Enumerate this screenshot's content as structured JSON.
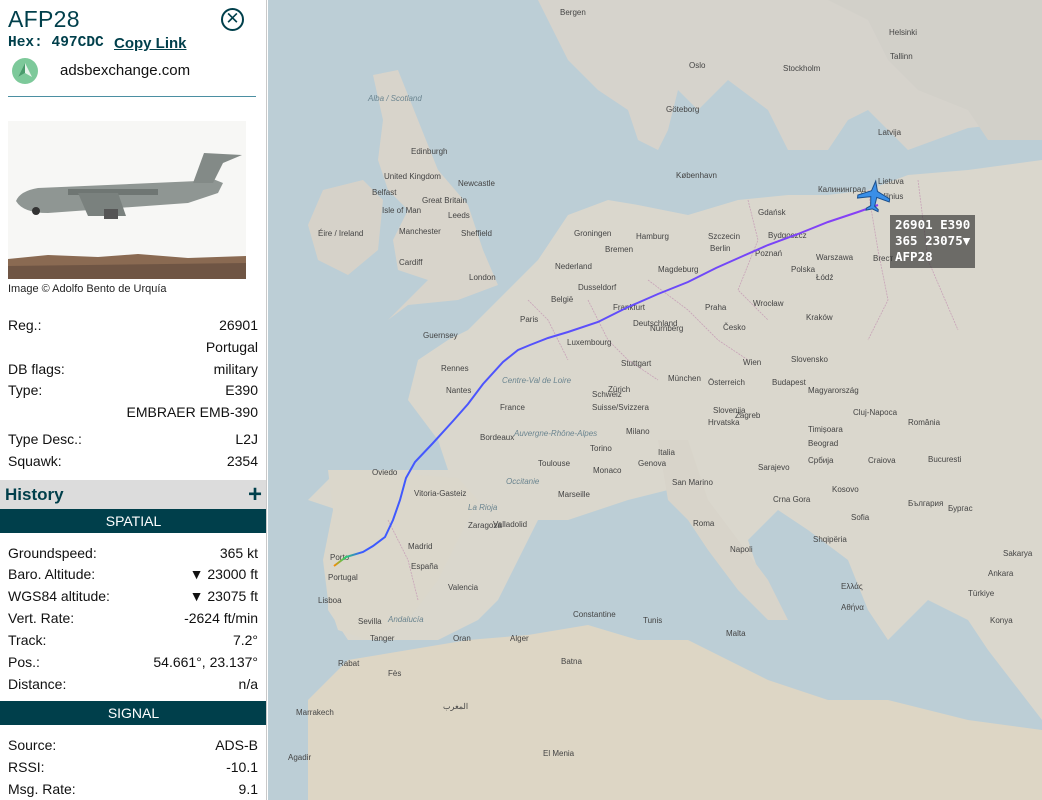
{
  "aircraft": {
    "callsign": "AFP28",
    "hex_text": "Hex: 497CDC",
    "copy_link_label": "Copy Link",
    "site_link": "adsbexchange.com",
    "photo_credit": "Image © Adolfo Bento de Urquía"
  },
  "details": [
    {
      "label": "Reg.:",
      "value": "26901"
    },
    {
      "label": "",
      "value": "Portugal"
    },
    {
      "label": "DB flags:",
      "value": "military"
    },
    {
      "label": "Type:",
      "value": "E390"
    },
    {
      "label": "",
      "value": "EMBRAER EMB-390"
    },
    {
      "label": "Type Desc.:",
      "value": "L2J"
    },
    {
      "label": "Squawk:",
      "value": "2354"
    }
  ],
  "history": {
    "title": "History",
    "expand_symbol": "+"
  },
  "spatial": {
    "header": "SPATIAL",
    "rows": [
      {
        "label": "Groundspeed:",
        "value": "365 kt"
      },
      {
        "label": "Baro. Altitude:",
        "value": "▼ 23000 ft"
      },
      {
        "label": "WGS84 altitude:",
        "value": "▼ 23075 ft"
      },
      {
        "label": "Vert. Rate:",
        "value": "-2624 ft/min"
      },
      {
        "label": "Track:",
        "value": "7.2°"
      },
      {
        "label": "Pos.:",
        "value": "54.661°, 23.137°"
      },
      {
        "label": "Distance:",
        "value": "n/a"
      }
    ]
  },
  "signal": {
    "header": "SIGNAL",
    "rows": [
      {
        "label": "Source:",
        "value": "ADS-B"
      },
      {
        "label": "RSSI:",
        "value": "-10.1"
      },
      {
        "label": "Msg. Rate:",
        "value": "9.1"
      }
    ]
  },
  "map": {
    "aircraft_label_line1": "26901 E390",
    "aircraft_label_line2": "365 23075▼",
    "aircraft_label_line3": "AFP28",
    "place_labels": [
      "Bergen",
      "Helsinki",
      "Oslo",
      "Stockholm",
      "Tallinn",
      "Göteborg",
      "Alba / Scotland",
      "Edinburgh",
      "Latvija",
      "København",
      "Lietuva",
      "Vilnius",
      "Калининград",
      "United Kingdom",
      "Newcastle",
      "Belfast",
      "Great Britain",
      "Isle of Man",
      "Leeds",
      "Gdańsk",
      "Éire / Ireland",
      "Manchester",
      "Sheffield",
      "Hamburg",
      "Szczecin",
      "Bydgoszcz",
      "Groningen",
      "Bremen",
      "Berlin",
      "Poznań",
      "Warszawa",
      "Brест",
      "Cardiff",
      "London",
      "Nederland",
      "Polska",
      "Magdeburg",
      "Dusseldorf",
      "Łódź",
      "België",
      "Frankfurt",
      "Kraków",
      "Luxembourg",
      "Deutschland",
      "Wrocław",
      "Paris",
      "Praha",
      "Guernsey",
      "Nürnberg",
      "Česko",
      "Rennes",
      "Stuttgart",
      "Slovensko",
      "Nantes",
      "München",
      "Wien",
      "Budapest",
      "Centre-Val de Loire",
      "Österreich",
      "Magyarország",
      "France",
      "Schweiz",
      "Suisse/Svizzera",
      "Slovenija",
      "Zürich",
      "Timișoara",
      "Cluj-Napoca",
      "România",
      "Milano",
      "Hrvatska",
      "Bordeaux",
      "Auvergne-Rhône-Alpes",
      "Beograd",
      "Bucuresti",
      "Torino",
      "Zagreb",
      "Italia",
      "Oviedo",
      "Toulouse",
      "Genova",
      "Monaco",
      "Србија",
      "Sarajevo",
      "Craiova",
      "Vitoria-Gasteiz",
      "Occitanie",
      "Marseille",
      "San Marino",
      "България",
      "Valladolid",
      "Crna Gora",
      "Kosovo",
      "Sofia",
      "Бургас",
      "La Rioja",
      "Zaragoza",
      "Roma",
      "Shqipëria",
      "Madrid",
      "Porto",
      "Portugal",
      "España",
      "Valencia",
      "Napoli",
      "Lisboa",
      "Sevilla",
      "Ελλάς",
      "Αθήνα",
      "Constantine",
      "Alger",
      "Tunis",
      "Oran",
      "Batna",
      "Andalucía",
      "Rabat",
      "Fès",
      "المغرب",
      "Tanger",
      "Malta",
      "Sakarya",
      "Ankara",
      "Türkiye",
      "Konya",
      "Marrakech",
      "Agadir",
      "El Menia"
    ]
  }
}
